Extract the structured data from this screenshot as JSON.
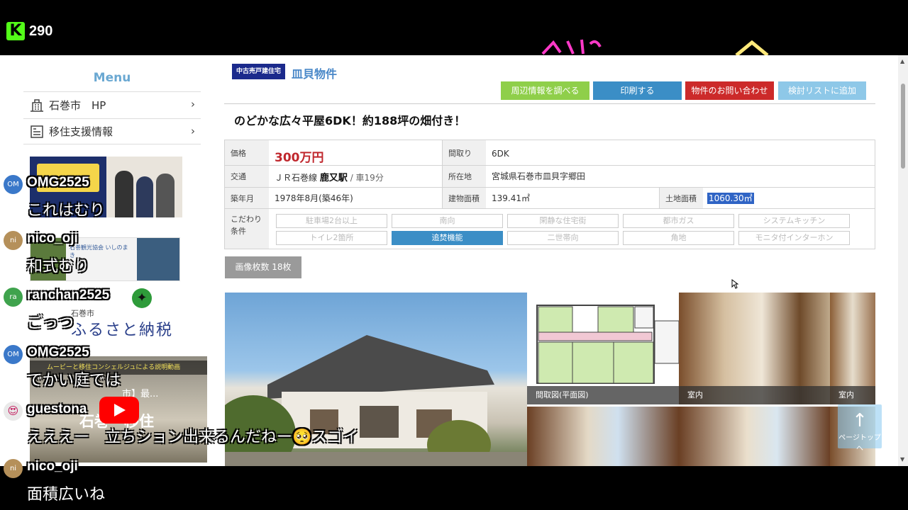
{
  "stream": {
    "viewer_count": "290"
  },
  "sidebar": {
    "menu_title": "Menu",
    "items": [
      {
        "label": "石巻市　HP"
      },
      {
        "label": "移住支援情報"
      }
    ],
    "banner2_text": "石巻観光協会 いしのまき",
    "furusato_small": "石巻市",
    "furusato_big": "ふるさと納税",
    "video_title": "ムービーと移住コンシェルジュによる説明動画",
    "video_overlay": "石巻　移住",
    "video_side": "市】最..."
  },
  "property": {
    "badge": "中古売戸建住宅",
    "name": "皿貝物件",
    "headline": "のどかな広々平屋6DK！約188坪の畑付き！",
    "actions": [
      "周辺情報を調べる",
      "印刷する",
      "物件のお問い合わせ",
      "検討リストに追加"
    ],
    "price_label": "価格",
    "price": "300万円",
    "layout_label": "間取り",
    "layout": "6DK",
    "access_label": "交通",
    "access_line": "ＪＲ石巻線",
    "access_station": "鹿又駅",
    "access_rest": "/ 車19分",
    "address_label": "所在地",
    "address": "宮城県石巻市皿貝字郷田",
    "built_label": "築年月",
    "built": "1978年8月(築46年)",
    "floor_label": "建物面積",
    "floor_area": "139.41㎡",
    "land_label": "土地面積",
    "land_area": "1060.30㎡",
    "features_label": "こだわり条件",
    "features": [
      "駐車場2台以上",
      "南向",
      "閑静な住宅街",
      "都市ガス",
      "システムキッチン",
      "トイレ2箇所",
      "追焚機能",
      "二世帯向",
      "角地",
      "モニタ付インターホン"
    ],
    "image_count": "画像枚数 18枚",
    "captions": [
      "間取図(平面図)",
      "室内",
      "室内"
    ],
    "page_top": "ページトップへ"
  },
  "chat": [
    {
      "user": "OMG2525",
      "initials": "OM",
      "message": "これはむり"
    },
    {
      "user": "nico_oji",
      "initials": "ni",
      "message": "和式むり"
    },
    {
      "user": "ranchan2525",
      "initials": "ra",
      "message": "ごっつ"
    },
    {
      "user": "OMG2525",
      "initials": "OM",
      "message": "でかい庭では"
    },
    {
      "user": "guestona",
      "initials": "",
      "message": "えええー　立ちション出来るんだねー🥺スゴイ"
    },
    {
      "user": "nico_oji",
      "initials": "ni",
      "message": "面積広いね"
    }
  ],
  "colors": {
    "kick_green": "#53fc18",
    "accent_blue": "#3b8ec6",
    "price_red": "#c0272d",
    "btn_green": "#8fcf4a",
    "btn_blue": "#3b8ec6",
    "btn_red": "#cc2a2a",
    "btn_light": "#8ec8e8"
  }
}
